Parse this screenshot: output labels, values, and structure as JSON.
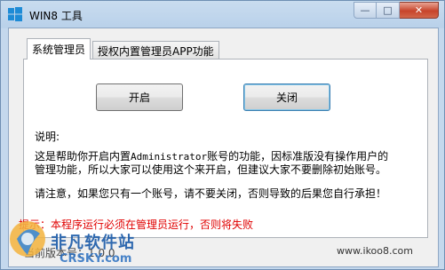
{
  "window": {
    "title": "WIN8 工具",
    "minimize_glyph": "—",
    "maximize_glyph": "□",
    "close_glyph": "✕"
  },
  "tabs": [
    {
      "label": "系统管理员",
      "active": true
    },
    {
      "label": "授权内置管理员APP功能",
      "active": false
    }
  ],
  "panel": {
    "open_button": "开启",
    "close_button": "关闭",
    "desc_title": "说明:",
    "desc_line1_prefix": "这是帮助你开启内置",
    "desc_line1_code": "Administrator",
    "desc_line1_suffix": "账号的功能，因标准版没有操作用户的",
    "desc_line2": "管理功能，所以大家可以使用这个来开启，但建议大家不要删除初始账号。",
    "notice": "请注意，如果您只有一个账号，请不要关闭，否则导致的后果您自行承担！"
  },
  "footer": {
    "warning": "提示：本程序运行必须在管理员运行，否则将失败",
    "version": "当前版本号：1.0.0",
    "website": "www.ikoo8.com"
  },
  "watermark": {
    "text": "非凡软件站",
    "url": "CRSKY.com"
  },
  "colors": {
    "warning": "#e00000",
    "titlebar": "#b9d1ea",
    "close_button": "#c7442b"
  }
}
